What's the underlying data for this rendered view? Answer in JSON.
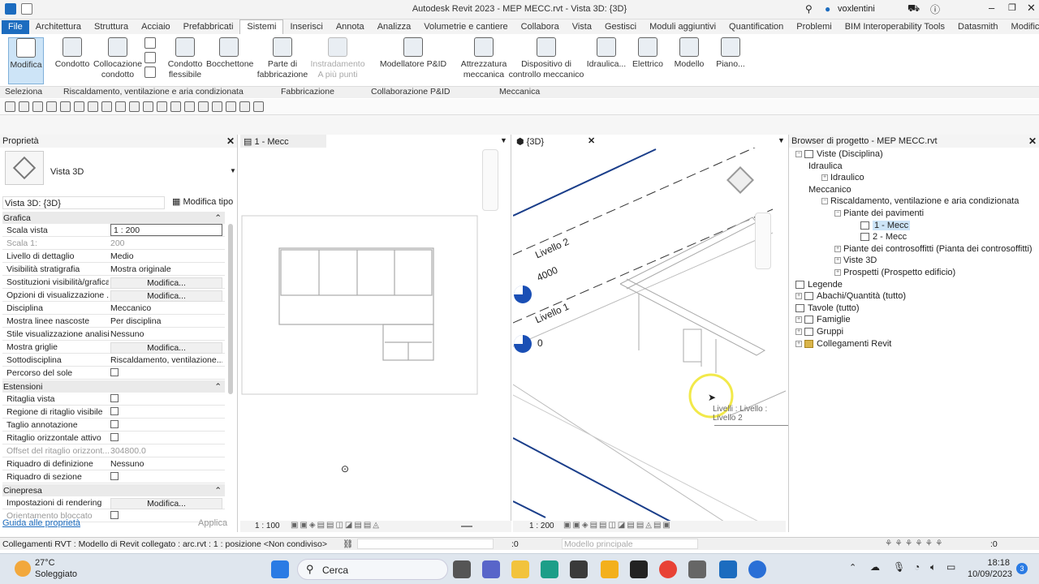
{
  "app_title": "Autodesk Revit 2023 - MEP MECC.rvt - Vista 3D: {3D}",
  "user": "voxlentini",
  "menu_tabs": [
    "File",
    "Architettura",
    "Struttura",
    "Acciaio",
    "Prefabbricati",
    "Sistemi",
    "Inserisci",
    "Annota",
    "Analizza",
    "Volumetrie e cantiere",
    "Collabora",
    "Vista",
    "Gestisci",
    "Moduli aggiuntivi",
    "Quantification",
    "Problemi",
    "BIM Interoperability Tools",
    "Datasmith",
    "Modifica"
  ],
  "active_tab": "Sistemi",
  "ribbon": {
    "modifica": "Modifica",
    "condotto": "Condotto",
    "collocazione_condotto": "Collocazione condotto",
    "condotto_flessibile": "Condotto flessibile",
    "bocchettone": "Bocchettone",
    "parte_fabbricazione": "Parte di fabbricazione",
    "instradamento": "Instradamento A più punti",
    "modellatore": "Modellatore P&ID",
    "attrezzatura": "Attrezzatura meccanica",
    "dispositivo": "Dispositivo di controllo meccanico",
    "idraulica": "Idraulica...",
    "elettrico": "Elettrico",
    "modello": "Modello",
    "piano": "Piano...",
    "panels": {
      "seleziona": "Seleziona",
      "hvac": "Riscaldamento, ventilazione e aria condizionata",
      "fabbricazione": "Fabbricazione",
      "collaborazione": "Collaborazione P&ID",
      "meccanica": "Meccanica"
    }
  },
  "properties": {
    "title": "Proprietà",
    "type_name": "Vista 3D",
    "selector": "Vista 3D: {3D}",
    "edit_type": "Modifica tipo",
    "sections": {
      "grafica": "Grafica",
      "estensioni": "Estensioni",
      "cinepresa": "Cinepresa"
    },
    "rows": [
      {
        "k": "Scala vista",
        "v": "1 : 200"
      },
      {
        "k": "Scala 1:",
        "v": "200"
      },
      {
        "k": "Livello di dettaglio",
        "v": "Medio"
      },
      {
        "k": "Visibilità stratigrafia",
        "v": "Mostra originale"
      },
      {
        "k": "Sostituzioni visibilità/grafica",
        "v": "Modifica..."
      },
      {
        "k": "Opzioni di visualizzazione ...",
        "v": "Modifica..."
      },
      {
        "k": "Disciplina",
        "v": "Meccanico"
      },
      {
        "k": "Mostra linee nascoste",
        "v": "Per disciplina"
      },
      {
        "k": "Stile visualizzazione analisi...",
        "v": "Nessuno"
      },
      {
        "k": "Mostra griglie",
        "v": "Modifica..."
      },
      {
        "k": "Sottodisciplina",
        "v": "Riscaldamento, ventilazione..."
      },
      {
        "k": "Percorso del sole",
        "v": ""
      }
    ],
    "ext_rows": [
      {
        "k": "Ritaglia vista",
        "v": ""
      },
      {
        "k": "Regione di ritaglio visibile",
        "v": ""
      },
      {
        "k": "Taglio annotazione",
        "v": ""
      },
      {
        "k": "Ritaglio orizzontale attivo",
        "v": ""
      },
      {
        "k": "Offset del ritaglio orizzont...",
        "v": "304800.0"
      },
      {
        "k": "Riquadro di definizione",
        "v": "Nessuno"
      },
      {
        "k": "Riquadro di sezione",
        "v": ""
      }
    ],
    "cam_rows": [
      {
        "k": "Impostazioni di rendering",
        "v": "Modifica..."
      },
      {
        "k": "Orientamento bloccato",
        "v": ""
      }
    ],
    "help_link": "Guida alle proprietà",
    "apply": "Applica"
  },
  "view1": {
    "tab": "1 - Mecc",
    "scale": "1 : 100"
  },
  "view2": {
    "tab": "{3D}",
    "scale": "1 : 200",
    "level2": "Livello 2",
    "level2_val": "4000",
    "level1": "Livello 1",
    "level1_val": "0",
    "tooltip": "Livelli : Livello : Livello 2"
  },
  "browser": {
    "title": "Browser di progetto - MEP MECC.rvt",
    "nodes": [
      "Viste (Disciplina)",
      "Idraulica",
      "Idraulico",
      "Meccanico",
      "Riscaldamento, ventilazione e aria condizionata",
      "Piante dei pavimenti",
      "1 - Mecc",
      "2 - Mecc",
      "Piante dei controsoffitti (Pianta dei controsoffitti)",
      "Viste 3D",
      "Prospetti (Prospetto edificio)",
      "Legende",
      "Abachi/Quantità (tutto)",
      "Tavole (tutto)",
      "Famiglie",
      "Gruppi",
      "Collegamenti Revit"
    ]
  },
  "status": {
    "text": "Collegamenti RVT : Modello di Revit collegato : arc.rvt : 1 : posizione <Non condiviso>",
    "count": ":0",
    "model": "Modello principale",
    "filter_count": ":0"
  },
  "taskbar": {
    "temp": "27°C",
    "weather": "Soleggiato",
    "search": "Cerca",
    "time": "18:18",
    "date": "10/09/2023",
    "badge": "3"
  },
  "colors": {
    "accent": "#1c6cbf",
    "selected_tab": "#ffffff",
    "level_head": "#1a4fb5"
  }
}
